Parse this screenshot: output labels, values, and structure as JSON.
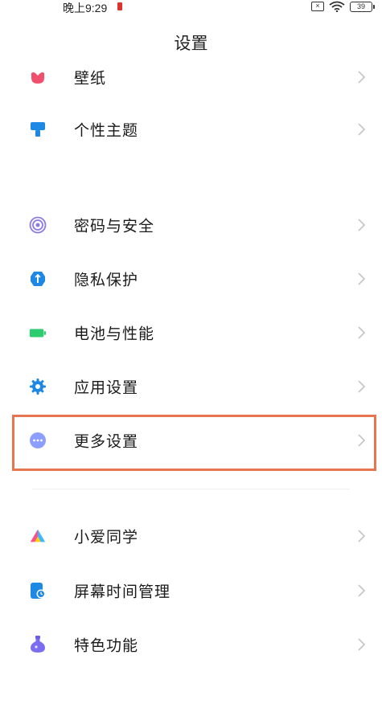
{
  "status_bar": {
    "time": "晚上9:29",
    "battery_level": "39"
  },
  "page": {
    "title": "设置"
  },
  "items": [
    {
      "label": "壁纸",
      "icon": "wallpaper-icon"
    },
    {
      "label": "个性主题",
      "icon": "theme-brush-icon"
    },
    {
      "label": "密码与安全",
      "icon": "fingerprint-icon"
    },
    {
      "label": "隐私保护",
      "icon": "privacy-shield-icon"
    },
    {
      "label": "电池与性能",
      "icon": "battery-icon"
    },
    {
      "label": "应用设置",
      "icon": "gear-icon"
    },
    {
      "label": "更多设置",
      "icon": "more-dots-icon"
    },
    {
      "label": "小爱同学",
      "icon": "xiaoai-icon"
    },
    {
      "label": "屏幕时间管理",
      "icon": "screen-time-icon"
    },
    {
      "label": "特色功能",
      "icon": "features-flask-icon"
    }
  ],
  "colors": {
    "highlight_border": "#e5764f",
    "wallpaper": "#f0506e",
    "theme": "#1e88e5",
    "security": "#8c7ae6",
    "privacy": "#1e88e5",
    "battery": "#2ecc71",
    "app_settings": "#1e88e5",
    "more": "#8c9eff"
  }
}
